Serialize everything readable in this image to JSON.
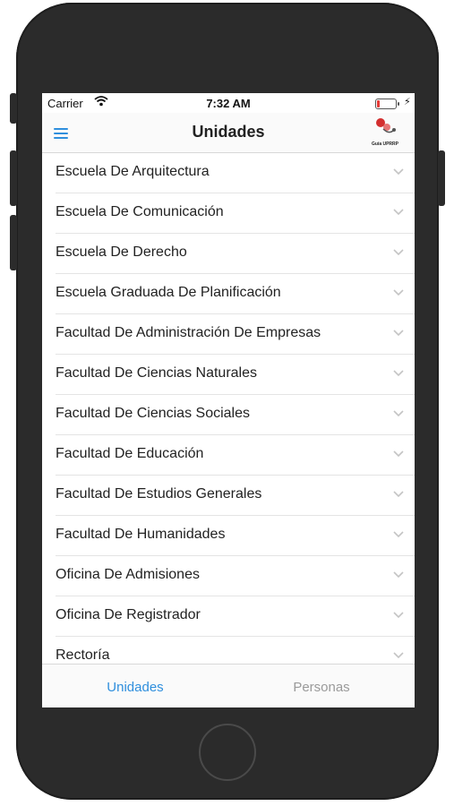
{
  "status_bar": {
    "carrier": "Carrier",
    "time": "7:32 AM",
    "icons": [
      "wifi-icon",
      "battery-icon",
      "charging-bolt-icon"
    ]
  },
  "nav": {
    "title": "Unidades",
    "menu_icon": "hamburger-menu-icon",
    "logo_text": "Guía UPRRP"
  },
  "units": [
    {
      "label": "Escuela De Arquitectura"
    },
    {
      "label": "Escuela De Comunicación"
    },
    {
      "label": "Escuela De Derecho"
    },
    {
      "label": "Escuela Graduada De Planificación"
    },
    {
      "label": "Facultad De Administración De Empresas"
    },
    {
      "label": "Facultad De Ciencias Naturales"
    },
    {
      "label": "Facultad De Ciencias Sociales"
    },
    {
      "label": "Facultad De Educación"
    },
    {
      "label": "Facultad De Estudios Generales"
    },
    {
      "label": "Facultad De Humanidades"
    },
    {
      "label": "Oficina De Admisiones"
    },
    {
      "label": "Oficina De Registrador"
    },
    {
      "label": "Rectoría"
    }
  ],
  "tabs": [
    {
      "label": "Unidades",
      "active": true
    },
    {
      "label": "Personas",
      "active": false
    }
  ],
  "colors": {
    "accent": "#2f8fdd",
    "inactive_tab": "#9a9a9a",
    "battery_low": "#e53935"
  }
}
